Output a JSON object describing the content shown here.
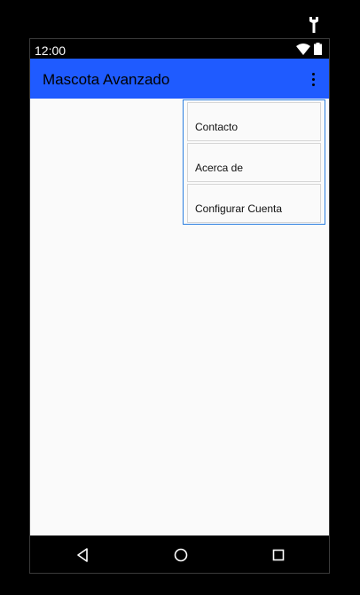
{
  "status_bar": {
    "time": "12:00"
  },
  "app_bar": {
    "title": "Mascota Avanzado"
  },
  "menu": {
    "items": [
      {
        "label": "Contacto"
      },
      {
        "label": "Acerca de"
      },
      {
        "label": "Configurar Cuenta"
      }
    ]
  },
  "icons": {
    "wrench": "wrench-icon",
    "wifi": "wifi-icon",
    "battery": "battery-icon",
    "overflow": "more-vert-icon",
    "back": "back-triangle-icon",
    "home": "home-circle-icon",
    "recents": "recents-square-icon"
  },
  "colors": {
    "app_bar": "#1f5bff",
    "background": "#fafafa",
    "menu_border": "#2b7fe0"
  }
}
